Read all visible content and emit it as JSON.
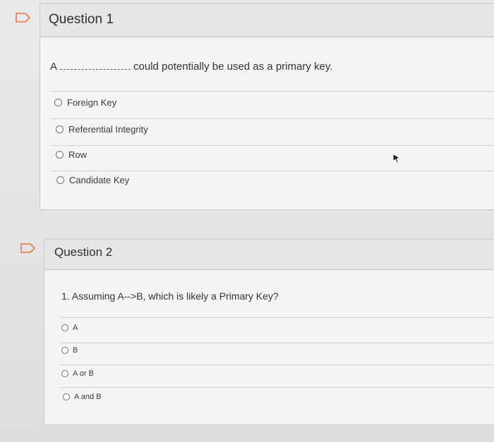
{
  "question1": {
    "title": "Question 1",
    "prompt_prefix": "A",
    "prompt_suffix": "could potentially be used as a primary key.",
    "options": [
      "Foreign Key",
      "Referential Integrity",
      "Row",
      "Candidate Key"
    ]
  },
  "question2": {
    "title": "Question 2",
    "prompt": "1. Assuming A-->B, which is likely a Primary Key?",
    "options": [
      "A",
      "B",
      "A or B",
      "A and B"
    ]
  },
  "icons": {
    "flag": "flag-icon",
    "cursor": "mouse-pointer-icon"
  },
  "colors": {
    "flag_orange": "#e8733a",
    "flag_border": "#a0a0a5"
  }
}
